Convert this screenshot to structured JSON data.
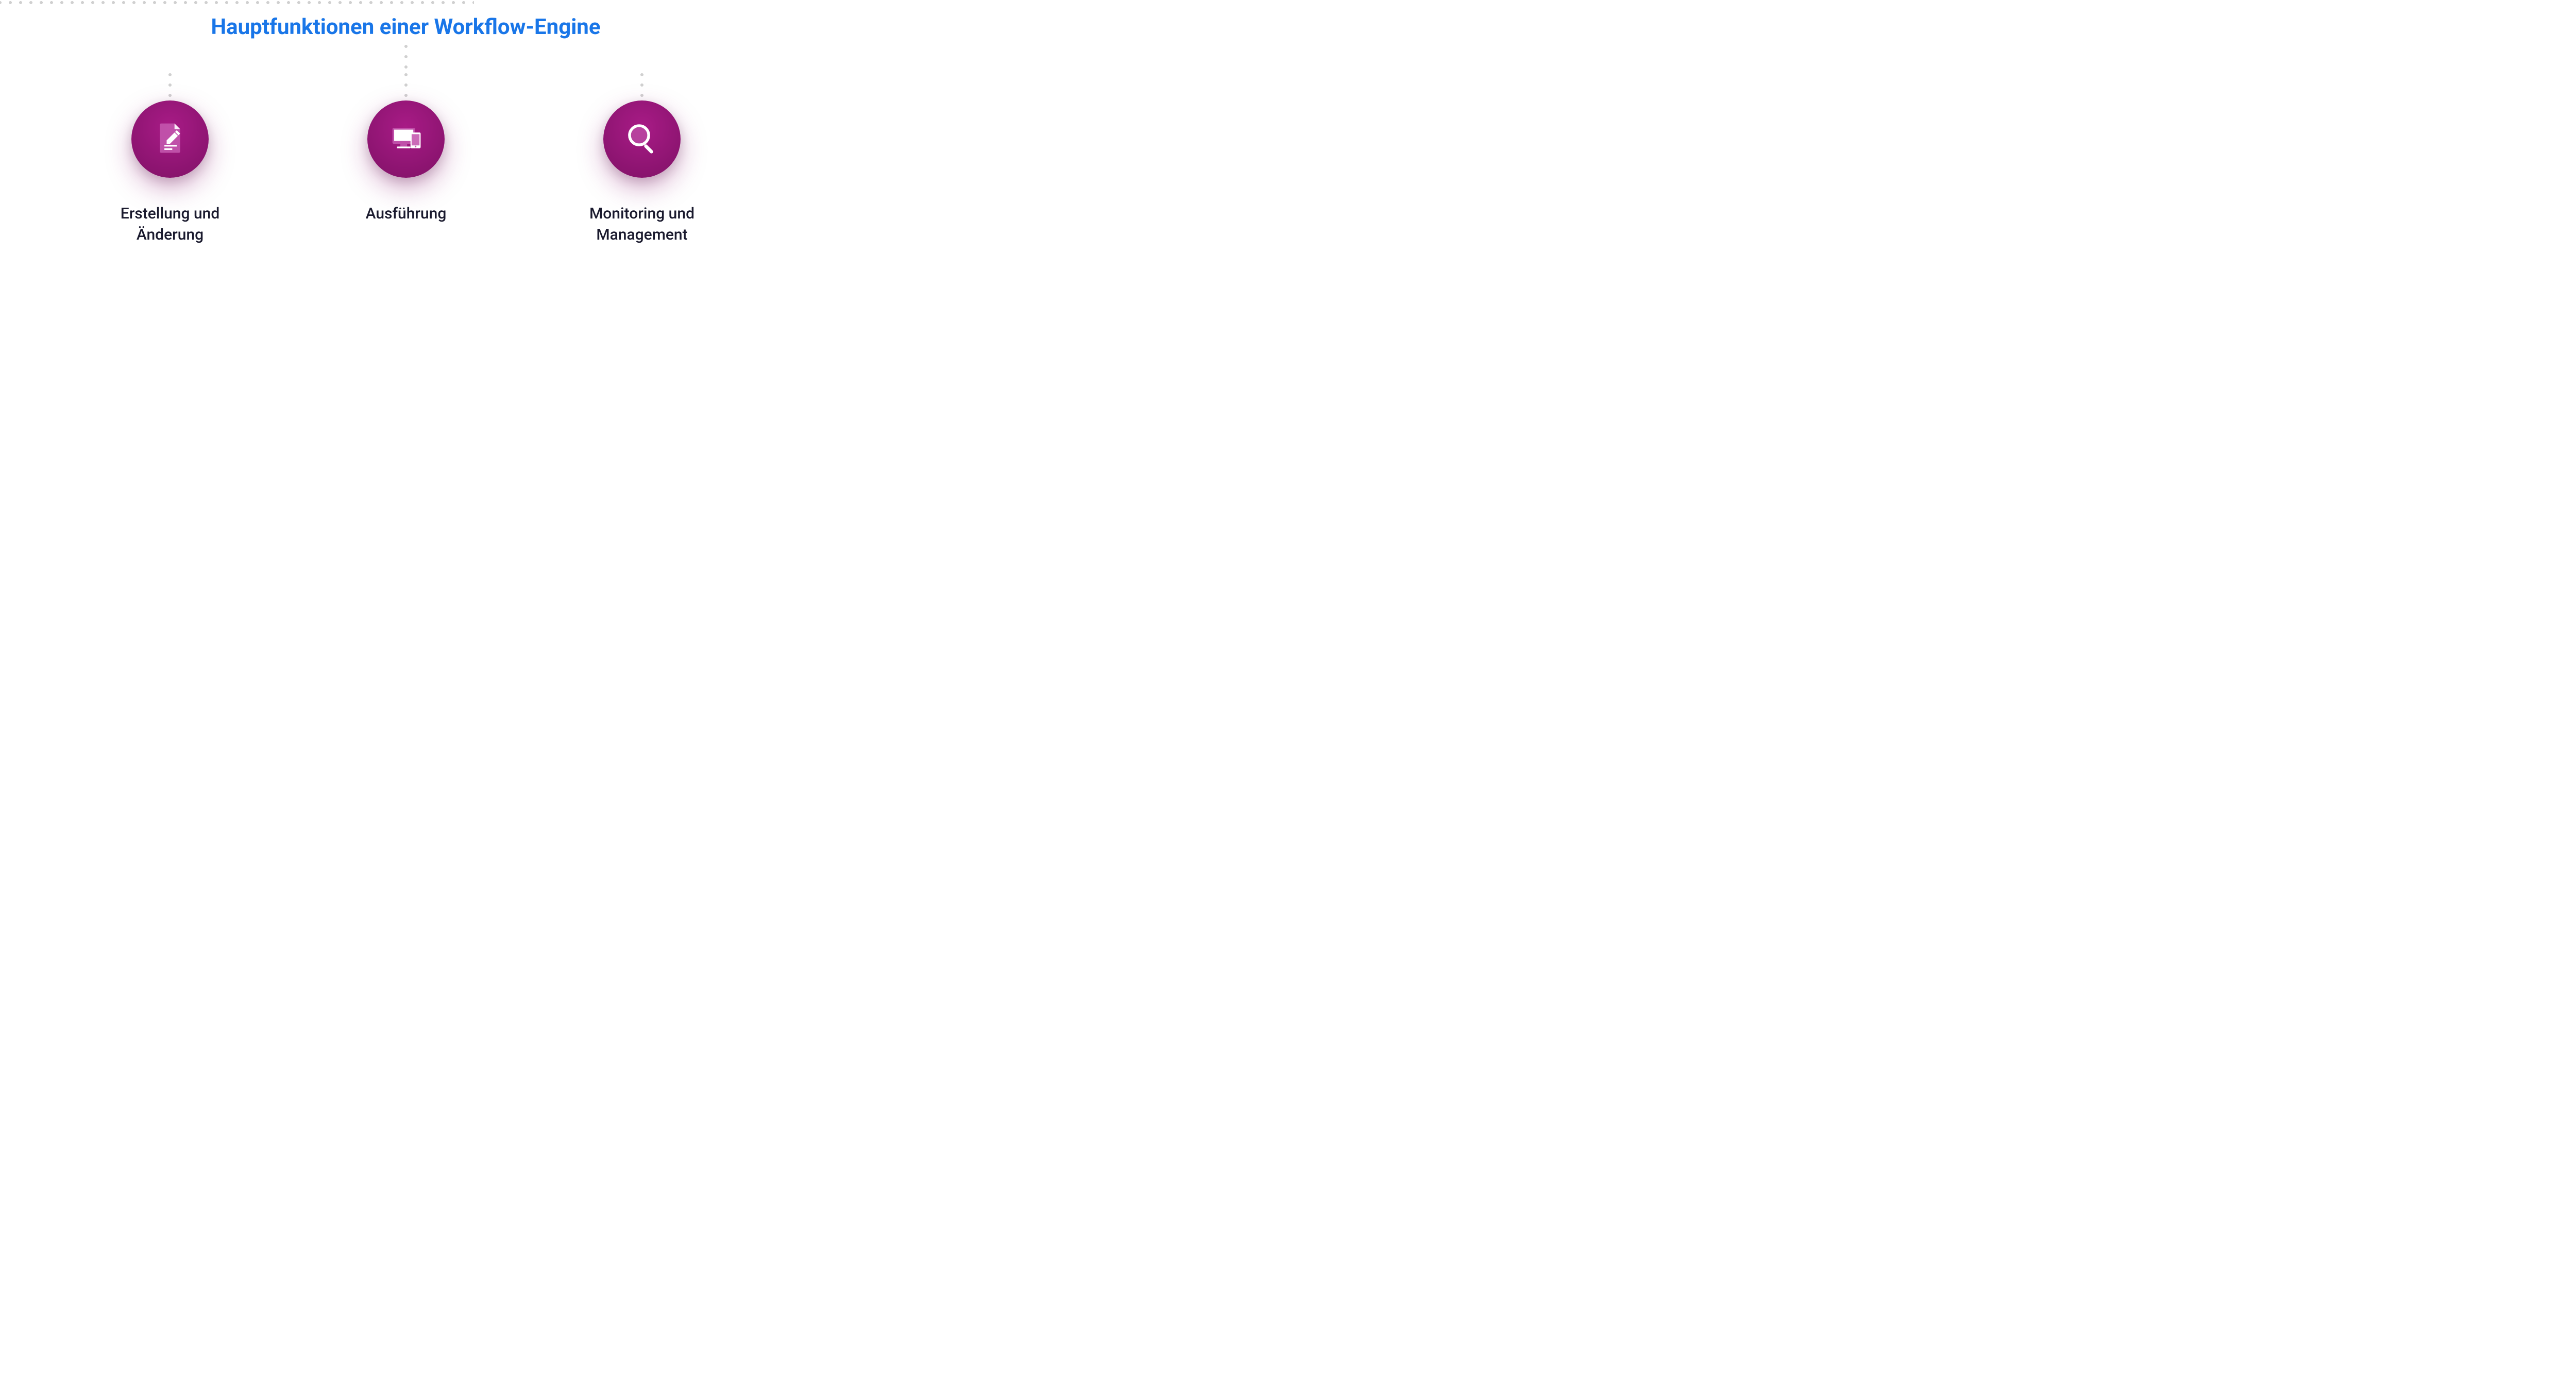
{
  "title": "Hauptfunktionen einer Workflow-Engine",
  "colors": {
    "title": "#1976e8",
    "circle_gradient_inner": "#a81b86",
    "circle_gradient_outer": "#7d1264",
    "dot": "#d0d0d0",
    "label": "#1a1a2e"
  },
  "nodes": [
    {
      "icon": "document-edit-icon",
      "label": "Erstellung und Änderung"
    },
    {
      "icon": "devices-icon",
      "label": "Ausführung"
    },
    {
      "icon": "magnifier-icon",
      "label": "Monitoring und Management"
    }
  ]
}
